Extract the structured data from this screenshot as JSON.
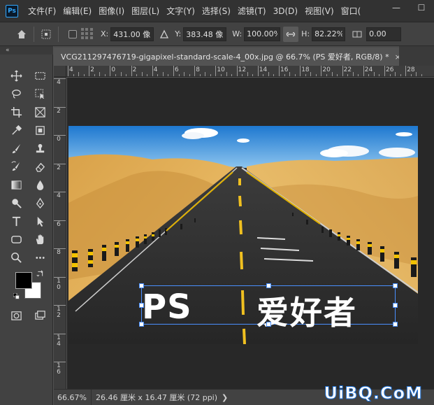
{
  "app": {
    "logo": "Ps"
  },
  "menu": [
    "文件(F)",
    "编辑(E)",
    "图像(I)",
    "图层(L)",
    "文字(Y)",
    "选择(S)",
    "滤镜(T)",
    "3D(D)",
    "视图(V)",
    "窗口("
  ],
  "window_controls": {
    "minimize": "—",
    "maximize": "☐"
  },
  "options": {
    "x_label": "X:",
    "x_value": "431.00 像",
    "y_label": "Y:",
    "y_value": "383.48 像",
    "w_label": "W:",
    "w_value": "100.00%",
    "h_label": "H:",
    "h_value": "82.22%",
    "rot_value": "0.00"
  },
  "toolpanel": {
    "collapse": "«"
  },
  "document": {
    "tab_title": "VCG211297476719-gigapixel-standard-scale-4_00x.jpg @ 66.7% (PS    爱好者, RGB/8) *",
    "tab_close": "×"
  },
  "ruler_top": [
    "4",
    "2",
    "0",
    "2",
    "4",
    "6",
    "8",
    "10",
    "12",
    "14",
    "16",
    "18",
    "20",
    "22",
    "24",
    "26",
    "28"
  ],
  "ruler_left": [
    "4",
    "2",
    "0",
    "2",
    "4",
    "6",
    "8",
    "1\n0",
    "1\n2",
    "1\n4",
    "1\n6"
  ],
  "text_layer": {
    "left": "PS",
    "right": "爱好者"
  },
  "status": {
    "zoom": "66.67%",
    "info": "26.46 厘米 x 16.47 厘米 (72 ppi)",
    "arrow": "❯"
  },
  "watermark": "UiBQ.CoM",
  "colors": {
    "foreground": "#000000",
    "background": "#ffffff",
    "accent": "#31a8ff"
  }
}
